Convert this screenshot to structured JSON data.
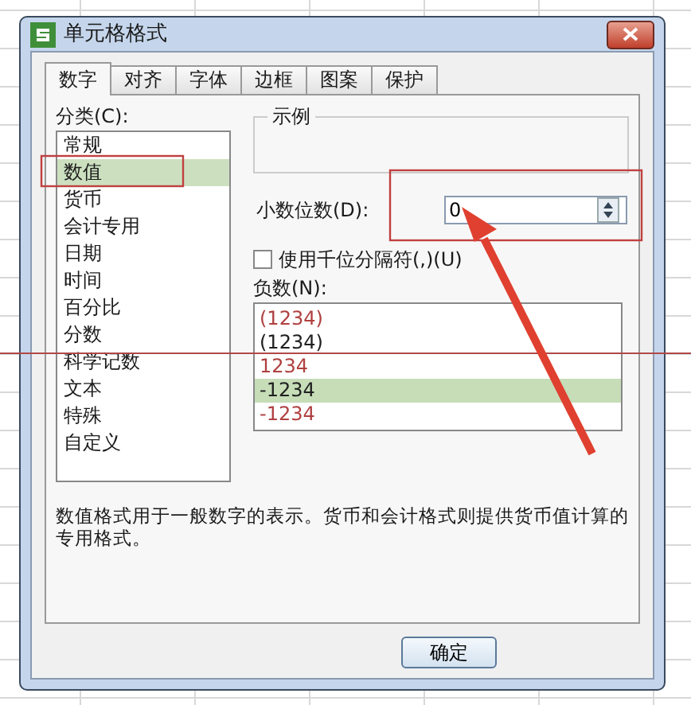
{
  "window": {
    "title": "单元格格式"
  },
  "tabs": [
    {
      "label": "数字",
      "selected": true
    },
    {
      "label": "对齐",
      "selected": false
    },
    {
      "label": "字体",
      "selected": false
    },
    {
      "label": "边框",
      "selected": false
    },
    {
      "label": "图案",
      "selected": false
    },
    {
      "label": "保护",
      "selected": false
    }
  ],
  "category": {
    "label": "分类(C):",
    "items": [
      {
        "label": "常规",
        "selected": false
      },
      {
        "label": "数值",
        "selected": true
      },
      {
        "label": "货币",
        "selected": false
      },
      {
        "label": "会计专用",
        "selected": false
      },
      {
        "label": "日期",
        "selected": false
      },
      {
        "label": "时间",
        "selected": false
      },
      {
        "label": "百分比",
        "selected": false
      },
      {
        "label": "分数",
        "selected": false
      },
      {
        "label": "科学记数",
        "selected": false
      },
      {
        "label": "文本",
        "selected": false
      },
      {
        "label": "特殊",
        "selected": false
      },
      {
        "label": "自定义",
        "selected": false
      }
    ]
  },
  "sample": {
    "label": "示例"
  },
  "decimal_places": {
    "label": "小数位数(D):",
    "value": "0"
  },
  "thousands_separator": {
    "label": "使用千位分隔符(,)(U)",
    "checked": false
  },
  "negative_numbers": {
    "label": "负数(N):",
    "items": [
      {
        "text": "(1234)",
        "color": "#b04040",
        "selected": false
      },
      {
        "text": "(1234)",
        "color": "#202020",
        "selected": false
      },
      {
        "text": "1234",
        "color": "#b04040",
        "selected": false
      },
      {
        "text": "-1234",
        "color": "#202020",
        "selected": true
      },
      {
        "text": "-1234",
        "color": "#b04040",
        "selected": false
      }
    ]
  },
  "description": "数值格式用于一般数字的表示。货币和会计格式则提供货币值计算的专用格式。",
  "buttons": [
    "确定"
  ]
}
